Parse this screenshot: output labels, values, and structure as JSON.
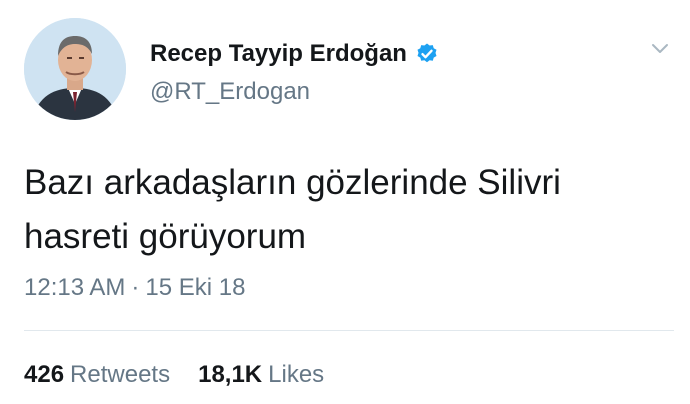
{
  "author": {
    "display_name": "Recep Tayyip Erdoğan",
    "handle": "@RT_Erdogan",
    "verified": true,
    "avatar_icon": "profile-photo",
    "verified_color": "#1da1f2"
  },
  "tweet": {
    "text": "Bazı arkadaşların gözlerinde Silivri hasreti görüyorum",
    "time": "12:13 AM",
    "separator": "·",
    "date": "15 Eki 18"
  },
  "stats": {
    "retweets_count": "426",
    "retweets_label": "Retweets",
    "likes_count": "18,1K",
    "likes_label": "Likes"
  },
  "menu": {
    "icon": "chevron-down-icon"
  },
  "colors": {
    "text_primary": "#14171a",
    "text_secondary": "#657786",
    "divider": "#e1e8ed"
  }
}
